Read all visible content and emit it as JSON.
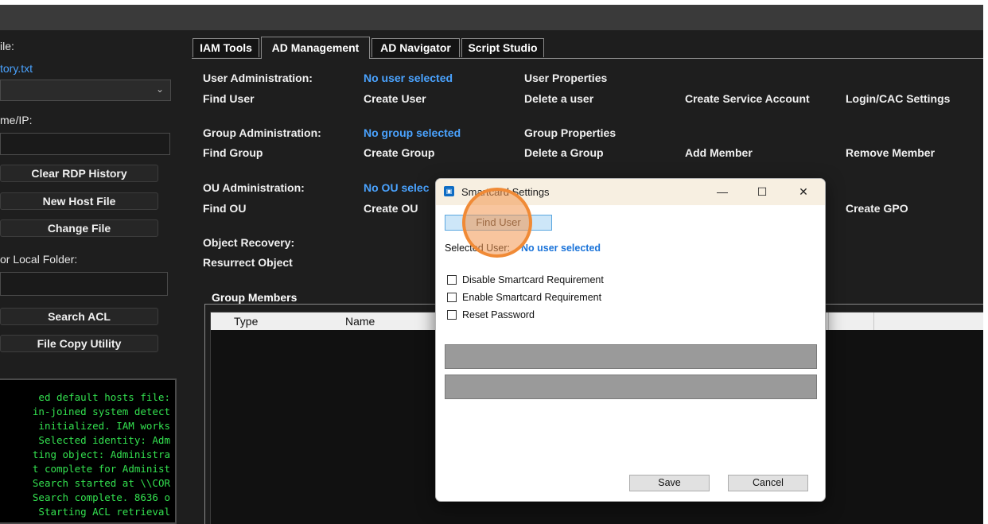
{
  "left_panel": {
    "file_label": "ile:",
    "file_link": "tory.txt",
    "hostname_label": "me/IP:",
    "buttons": [
      "Clear RDP History",
      "New Host File",
      "Change File"
    ],
    "folder_label": "or Local Folder:",
    "buttons2": [
      "Search ACL",
      "File Copy Utility"
    ],
    "console_lines": [
      "ed default hosts file:",
      "in-joined system detect",
      " initialized. IAM works",
      " Selected identity: Adm",
      "ting object: Administra",
      "t complete for Administ",
      "Search started at \\\\COR",
      "Search complete. 8636 o",
      " Starting ACL retrieval"
    ]
  },
  "tabs": [
    "IAM Tools",
    "AD Management",
    "AD Navigator",
    "Script Studio"
  ],
  "user_admin": {
    "header": "User Administration:",
    "status": "No user selected",
    "properties": "User Properties",
    "actions": [
      "Find User",
      "Create User",
      "Delete a user",
      "Create Service Account",
      "Login/CAC Settings"
    ]
  },
  "group_admin": {
    "header": "Group Administration:",
    "status": "No group selected",
    "properties": "Group Properties",
    "actions": [
      "Find Group",
      "Create Group",
      "Delete a Group",
      "Add Member",
      "Remove Member"
    ]
  },
  "ou_admin": {
    "header": "OU Administration:",
    "status": "No OU selec",
    "actions": [
      "Find OU",
      "Create OU",
      "Create GPO"
    ]
  },
  "recovery": {
    "header": "Object Recovery:",
    "action": "Resurrect Object"
  },
  "group_members": {
    "title": "Group Members",
    "columns": [
      "Type",
      "Name"
    ]
  },
  "dialog": {
    "title": "Smartcard Settings",
    "find_button": "Find User",
    "selected_label": "Selected User:",
    "selected_value": "No user selected",
    "checkboxes": [
      "Disable Smartcard Requirement",
      "Enable Smartcard Requirement",
      "Reset Password"
    ],
    "save": "Save",
    "cancel": "Cancel",
    "controls": {
      "minimize": "—",
      "maximize": "☐",
      "close": "✕"
    }
  },
  "colors": {
    "accent_link": "#4aa3ff",
    "console_text": "#33e04f",
    "highlight": "#f08a36"
  }
}
